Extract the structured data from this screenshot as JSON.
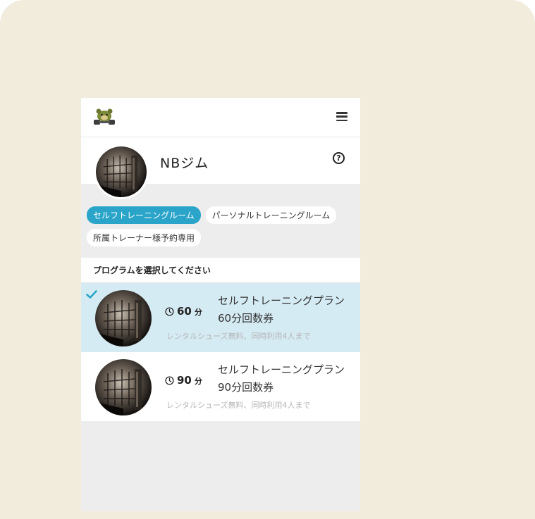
{
  "header": {
    "gym_name": "NBジム"
  },
  "tags": [
    {
      "label": "セルフトレーニングルーム",
      "active": true
    },
    {
      "label": "パーソナルトレーニングルーム",
      "active": false
    },
    {
      "label": "所属トレーナー様予約専用",
      "active": false
    }
  ],
  "section": {
    "title": "プログラムを選択してください"
  },
  "programs": [
    {
      "duration": "60",
      "unit": "分",
      "title": "セルフトレーニングプラン 60分回数券",
      "subtitle": "レンタルシューズ無料、同時利用4人まで",
      "selected": true
    },
    {
      "duration": "90",
      "unit": "分",
      "title": "セルフトレーニングプラン 90分回数券",
      "subtitle": "レンタルシューズ無料、同時利用4人まで",
      "selected": false
    }
  ],
  "icons": {
    "logo": "bear-mascot-logo",
    "menu": "hamburger-menu-icon",
    "help": "question-circle-icon",
    "check": "checkmark-icon",
    "clock": "clock-icon"
  },
  "colors": {
    "accent": "#2aa5c9",
    "selected_bg": "#d5ebf3",
    "page_bg": "#f2ecdc"
  }
}
